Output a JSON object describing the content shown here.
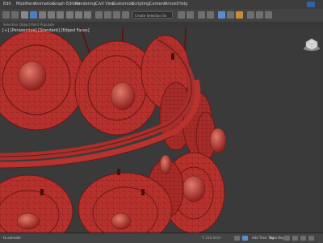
{
  "menu": {
    "items": [
      "Edit",
      "Modifiers",
      "Animation",
      "Graph Editors",
      "Rendering",
      "Civil View",
      "Customize",
      "Scripting",
      "Content",
      "Arnold",
      "Help"
    ]
  },
  "toolbar": {
    "selection_set_placeholder": "Create Selection Se"
  },
  "ribbon": {
    "items": [
      "Selection",
      "Object Paint",
      "Populate"
    ]
  },
  "viewport": {
    "label": "[+] [Perspective] [Standard] [Edged Faces]",
    "mesh_color": "#b8322e",
    "background_color": "#3a3a3a",
    "viewcube_icon": "viewcube-icon"
  },
  "statusbar": {
    "left_text": "to animate",
    "coords": "Y: 210.0mm",
    "add_time_tag": "Add Time Tag",
    "auto_key": "Auto Key"
  },
  "colors": {
    "toolbar_bg": "#434343",
    "accent": "#4a7fc1"
  }
}
